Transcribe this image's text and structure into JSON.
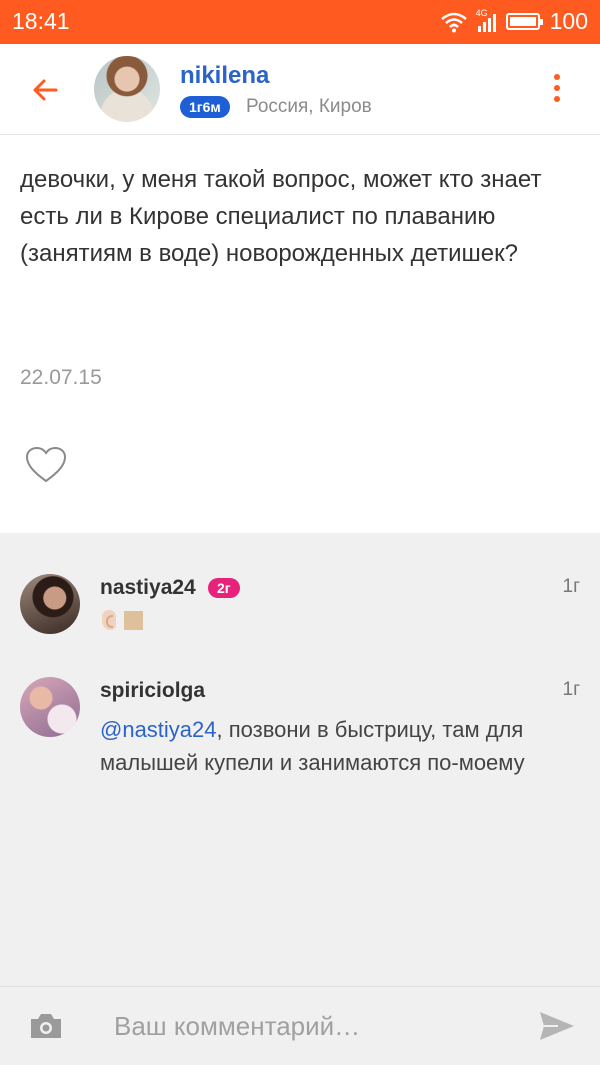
{
  "status_bar": {
    "time": "18:41",
    "network": "4G",
    "battery": "100"
  },
  "header": {
    "back_icon": "arrow-left-icon",
    "user": {
      "name": "nikilena",
      "badge": "1г6м",
      "location": "Россия, Киров"
    },
    "menu_icon": "kebab-menu-icon"
  },
  "post": {
    "text": "девочки, у меня такой вопрос, может кто знает есть ли в Кирове специалист по плаванию (занятиям в воде) новорожденных детишек?",
    "date": "22.07.15",
    "like_icon": "heart-outline-icon"
  },
  "comments": [
    {
      "author": "nastiya24",
      "badge": "2г",
      "time": "1г",
      "emoji": [
        "ear",
        "square"
      ]
    },
    {
      "author": "spiriciolga",
      "time": "1г",
      "mention": "@nastiya24",
      "text": ", позвони в быстрицу, там для малышей купели и занимаются по-моему"
    }
  ],
  "composer": {
    "placeholder": "Ваш комментарий…",
    "camera_icon": "camera-icon",
    "send_icon": "send-icon"
  },
  "colors": {
    "accent": "#ff5a1f",
    "link": "#2b63c9",
    "badge_blue": "#1f5fd6",
    "badge_pink": "#e8217a"
  }
}
